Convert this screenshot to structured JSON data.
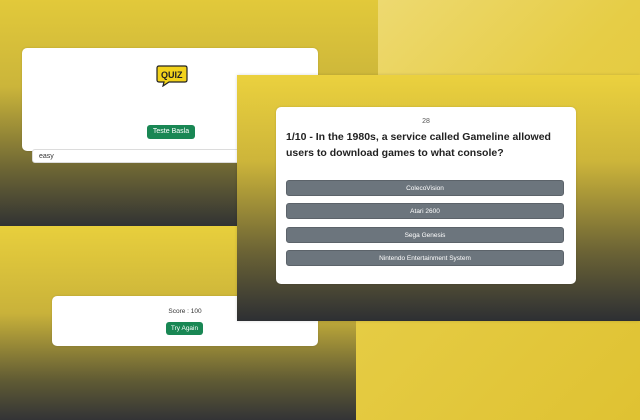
{
  "login": {
    "logo_text": "QUIZ",
    "difficulty_value": "easy",
    "start_label": "Teste Basla"
  },
  "result": {
    "score_text": "Score : 100",
    "try_again_label": "Try Again"
  },
  "question_view": {
    "timer": "28",
    "question_text": "1/10 - In the 1980s, a service called Gameline allowed users to download games to what console?",
    "answers": [
      "ColecoVision",
      "Atari 2600",
      "Sega Genesis",
      "Nintendo Entertainment System"
    ]
  },
  "colors": {
    "accent_green": "#198754",
    "answer_gray": "#6c757d",
    "logo_yellow": "#f2d21b"
  },
  "icons": [
    "quiz-logo-icon"
  ]
}
